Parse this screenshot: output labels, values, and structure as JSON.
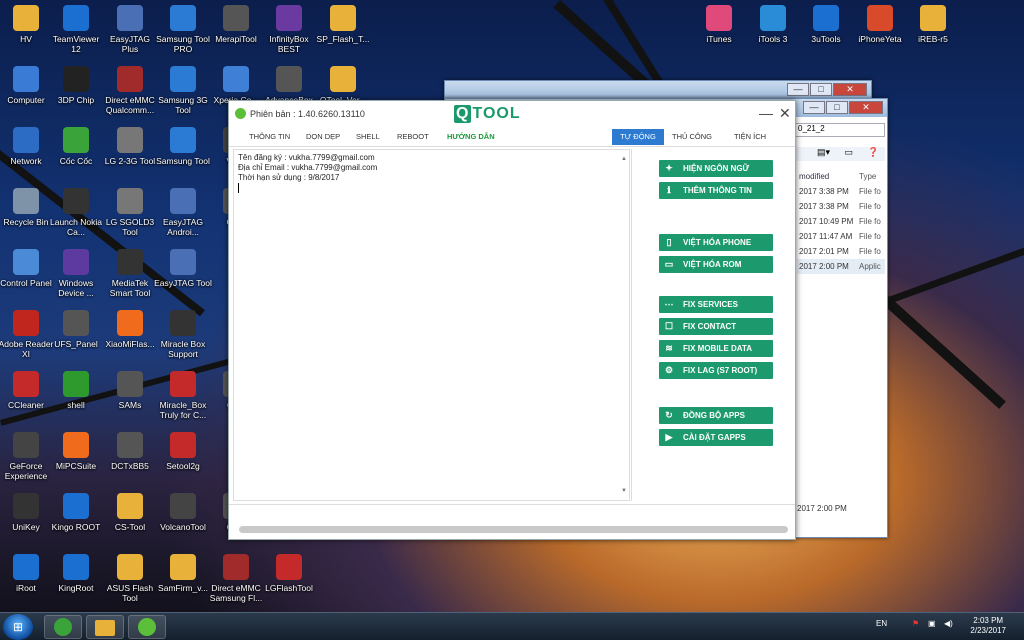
{
  "desktop": {
    "icons_left": [
      {
        "label": "HV",
        "icon": "folder-icon",
        "color": "#e8b23a"
      },
      {
        "label": "TeamViewer 12",
        "icon": "teamviewer-icon",
        "color": "#1b6fd1"
      },
      {
        "label": "EasyJTAG Plus",
        "icon": "tools-icon",
        "color": "#4a6fb5"
      },
      {
        "label": "Samsung Tool PRO",
        "icon": "gear-icon",
        "color": "#2b7bd4"
      },
      {
        "label": "MerapiTool",
        "icon": "merapi-icon",
        "color": "#555555"
      },
      {
        "label": "InfinityBox BEST",
        "icon": "infinity-icon",
        "color": "#6a3aa0"
      },
      {
        "label": "SP_Flash_T...",
        "icon": "folder-icon",
        "color": "#e8b23a"
      },
      {
        "label": "Computer",
        "icon": "computer-icon",
        "color": "#3a7bd5"
      },
      {
        "label": "3DP Chip",
        "icon": "chip-icon",
        "color": "#222222"
      },
      {
        "label": "Direct eMMC Qualcomm...",
        "icon": "tools-icon",
        "color": "#a12a2a"
      },
      {
        "label": "Samsung 3G Tool",
        "icon": "gear-icon",
        "color": "#2b7bd4"
      },
      {
        "label": "Xperia Co...",
        "icon": "xperia-icon",
        "color": "#3f7fd6"
      },
      {
        "label": "AdvanceBox Tool",
        "icon": "box-icon",
        "color": "#555555"
      },
      {
        "label": "QTool_Ver...",
        "icon": "folder-icon",
        "color": "#e8b23a"
      },
      {
        "label": "Network",
        "icon": "network-icon",
        "color": "#2d6cc4"
      },
      {
        "label": "Cốc Cốc",
        "icon": "coccoc-icon",
        "color": "#3aa33a"
      },
      {
        "label": "LG 2-3G Tool",
        "icon": "tools-icon",
        "color": "#777777"
      },
      {
        "label": "Samsung Tool",
        "icon": "gear-icon",
        "color": "#2b7bd4"
      },
      {
        "label": "Vol...",
        "icon": "volcano-icon",
        "color": "#444444"
      },
      {
        "label": "Recycle Bin",
        "icon": "trash-icon",
        "color": "#7f93a8"
      },
      {
        "label": "Launch Nokia Ca...",
        "icon": "nokia-icon",
        "color": "#333333"
      },
      {
        "label": "LG SGOLD3 Tool",
        "icon": "tools-icon",
        "color": "#777777"
      },
      {
        "label": "EasyJTAG Androi...",
        "icon": "tools-icon",
        "color": "#4a6fb5"
      },
      {
        "label": "CS...",
        "icon": "tools-icon",
        "color": "#555555"
      },
      {
        "label": "Control Panel",
        "icon": "control-panel-icon",
        "color": "#4a8ad6"
      },
      {
        "label": "Windows Device ...",
        "icon": "device-icon",
        "color": "#5d3aa0"
      },
      {
        "label": "MediaTek Smart Tool",
        "icon": "mediatek-icon",
        "color": "#333333"
      },
      {
        "label": "EasyJTAG Tool",
        "icon": "tools-icon",
        "color": "#4a6fb5"
      },
      {
        "label": "Adobe Reader XI",
        "icon": "adobe-icon",
        "color": "#c1261e"
      },
      {
        "label": "UFS_Panel",
        "icon": "tools-icon",
        "color": "#555555"
      },
      {
        "label": "XiaoMiFlas...",
        "icon": "xiaomi-icon",
        "color": "#f06b1c"
      },
      {
        "label": "Miracle Box Support",
        "icon": "book-icon",
        "color": "#333333"
      },
      {
        "label": "CCleaner",
        "icon": "ccleaner-icon",
        "color": "#c42a2a"
      },
      {
        "label": "shell",
        "icon": "shell-icon",
        "color": "#2e9a2e"
      },
      {
        "label": "SAMs",
        "icon": "tools-icon",
        "color": "#555555"
      },
      {
        "label": "Miracle_Box Truly for C...",
        "icon": "miracle-icon",
        "color": "#c42a2a"
      },
      {
        "label": "QT...",
        "icon": "tools-icon",
        "color": "#555555"
      },
      {
        "label": "GeForce Experience",
        "icon": "nvidia-icon",
        "color": "#444444"
      },
      {
        "label": "MiPCSuite",
        "icon": "xiaomi-icon",
        "color": "#f06b1c"
      },
      {
        "label": "DCTxBB5",
        "icon": "tools-icon",
        "color": "#555555"
      },
      {
        "label": "Setool2g",
        "icon": "setool-icon",
        "color": "#c42a2a"
      },
      {
        "label": "UniKey",
        "icon": "unikey-icon",
        "color": "#333333"
      },
      {
        "label": "Kingo ROOT",
        "icon": "kingo-icon",
        "color": "#1b6fd1"
      },
      {
        "label": "CS-Tool",
        "icon": "folder-icon",
        "color": "#e8b23a"
      },
      {
        "label": "VolcanoTool",
        "icon": "volcano-icon",
        "color": "#444444"
      },
      {
        "label": "Od...",
        "icon": "tools-icon",
        "color": "#555555"
      },
      {
        "label": "iRoot",
        "icon": "iroot-icon",
        "color": "#1b6fd1"
      },
      {
        "label": "KingRoot",
        "icon": "kingroot-icon",
        "color": "#1b6fd1"
      },
      {
        "label": "ASUS Flash Tool",
        "icon": "folder-icon",
        "color": "#e8b23a"
      },
      {
        "label": "SamFirm_v...",
        "icon": "folder-icon",
        "color": "#e8b23a"
      },
      {
        "label": "Direct eMMC Samsung Fl...",
        "icon": "tools-icon",
        "color": "#a12a2a"
      },
      {
        "label": "LGFlashTool",
        "icon": "lgflash-icon",
        "color": "#c42a2a"
      }
    ],
    "icons_right": [
      {
        "label": "iTunes",
        "icon": "itunes-icon",
        "color": "#e04a7a"
      },
      {
        "label": "iTools 3",
        "icon": "itools-icon",
        "color": "#2a8bd6"
      },
      {
        "label": "3uTools",
        "icon": "3utools-icon",
        "color": "#1b6fd1"
      },
      {
        "label": "iPhoneYeta",
        "icon": "iphoneyeta-icon",
        "color": "#d84a2a"
      },
      {
        "label": "iREB-r5",
        "icon": "folder-icon",
        "color": "#e8b23a"
      }
    ]
  },
  "explorer_bg": {
    "path_fragment": "0_21_2",
    "col_modified": "modified",
    "col_type": "Type",
    "rows": [
      {
        "date": "2017 3:38 PM",
        "type": "File fo"
      },
      {
        "date": "2017 3:38 PM",
        "type": "File fo"
      },
      {
        "date": "2017 10:49 PM",
        "type": "File fo"
      },
      {
        "date": "2017 11:47 AM",
        "type": "File fo"
      },
      {
        "date": "2017 2:01 PM",
        "type": "File fo"
      },
      {
        "date": "2017 2:00 PM",
        "type": "Applic"
      }
    ],
    "footer": "2017 2:00 PM"
  },
  "qtool": {
    "version_label": "Phiên bản : 1.40.6260.13110",
    "brand": "TOOL",
    "brand_letter": "Q",
    "minimize": "—",
    "close": "✕",
    "menu_left": [
      "THÔNG TIN",
      "DỌN DẸP",
      "SHELL",
      "REBOOT",
      "HƯỚNG DẪN"
    ],
    "menu_right": [
      "TỰ ĐỘNG",
      "THỦ CÔNG",
      "TIỆN ÍCH"
    ],
    "active_right_tab": "TỰ ĐỘNG",
    "accent_color": "#1c9a6e",
    "log_lines": [
      "Tên đăng ký : vukha.7799@gmail.com",
      "Địa chỉ Email : vukha.7799@gmail.com",
      "Thời hạn sử dụng : 9/8/2017"
    ],
    "actions": [
      {
        "label": "HIỆN NGÔN NGỮ",
        "icon": "android-icon"
      },
      {
        "label": "THÊM THÔNG TIN",
        "icon": "info-icon"
      },
      {
        "label": "VIỆT HÓA PHONE",
        "icon": "phone-icon"
      },
      {
        "label": "VIỆT HÓA ROM",
        "icon": "rom-icon"
      },
      {
        "label": "FIX SERVICES",
        "icon": "share-icon"
      },
      {
        "label": "FIX CONTACT",
        "icon": "contact-icon"
      },
      {
        "label": "FIX MOBILE DATA",
        "icon": "wifi-icon"
      },
      {
        "label": "FIX LAG (S7 ROOT)",
        "icon": "gears-icon"
      },
      {
        "label": "ĐỒNG BỘ APPS",
        "icon": "sync-icon"
      },
      {
        "label": "CÀI ĐẶT GAPPS",
        "icon": "play-icon"
      }
    ],
    "progress": 0
  },
  "taskbar": {
    "start": "⊞",
    "lang": "EN",
    "time": "2:03 PM",
    "date": "2/23/2017"
  }
}
